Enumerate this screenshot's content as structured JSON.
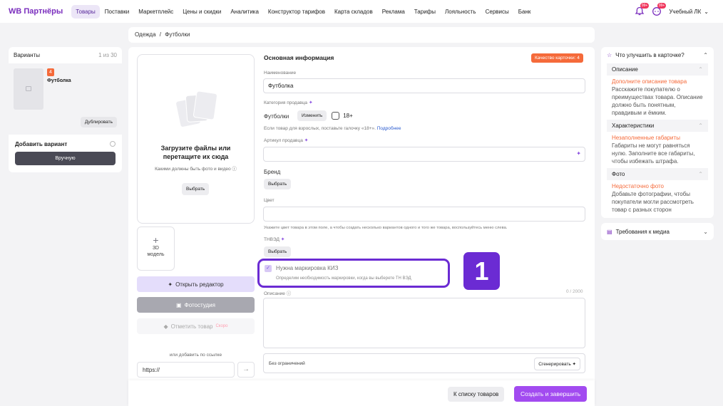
{
  "nav": {
    "logo": "WB Партнёры",
    "items": [
      "Товары",
      "Поставки",
      "Маркетплейс",
      "Цены и скидки",
      "Аналитика",
      "Конструктор тарифов",
      "Карта складов",
      "Реклама",
      "Тарифы",
      "Лояльность",
      "Сервисы",
      "Банк"
    ],
    "badge1": "99+",
    "badge2": "99+",
    "user": "Учебный ЛК"
  },
  "breadcrumb": {
    "root": "Одежда",
    "sep": "/",
    "current": "Футболки"
  },
  "variants": {
    "title": "Варианты",
    "count": "1 из 30",
    "badge": "4",
    "name": "Футболка",
    "duplicate": "Дублировать",
    "add": "Добавить вариант",
    "manual": "Вручную"
  },
  "upload": {
    "title": "Загрузите файлы или перетащите их сюда",
    "subtitle": "Какими должны быть фото и видео",
    "choose": "Выбрать",
    "model3d": "3D модель",
    "editor": "Открыть редактор",
    "studio": "Фотостудия",
    "mark": "Отметить товар",
    "soon": "Скоро",
    "or_link": "или добавить по ссылке",
    "url_value": "https://"
  },
  "form": {
    "section_title": "Основная информация",
    "quality": "Качество карточки: 4",
    "name_label": "Наименование",
    "name_value": "Футболка",
    "category_label": "Категория продавца",
    "category_value": "Футболки",
    "change": "Изменить",
    "adult": "18+",
    "adult_hint": "Если товар для взрослых, поставьте галочку «18+».",
    "more": "Подробнее",
    "article_label": "Артикул продавца",
    "brand_label": "Бренд",
    "choose": "Выбрать",
    "color_label": "Цвет",
    "color_hint": "Укажите цвет товара в этом поле, а чтобы создать несколько вариантов одного и того же товара, воспользуйтесь меню слева.",
    "tnved_label": "ТНВЭД",
    "kiz_label": "Нужна маркировка КИЗ",
    "kiz_hint": "Определим необходимость маркировки, когда вы выберете ТН ВЭД",
    "step": "1",
    "desc_label": "Описание",
    "desc_count": "0 / 2000",
    "no_limits": "Без ограничений",
    "generate": "Сгенерировать",
    "to_list": "К списку товаров",
    "create": "Создать и завершить"
  },
  "tips": {
    "title": "Что улучшить в карточке?",
    "sections": [
      {
        "head": "Описание",
        "link": "Дополните описание товара",
        "text": "Расскажите покупателю о преимуществах товара. Описание должно быть понятным, правдивым и ёмким."
      },
      {
        "head": "Характеристики",
        "link": "Незаполненные габариты",
        "text": "Габариты не могут равняться нулю. Заполните все габариты, чтобы избежать штрафа."
      },
      {
        "head": "Фото",
        "link": "Недостаточно фото",
        "text": "Добавьте фотографии, чтобы покупатели могли рассмотреть товар с разных сторон"
      }
    ],
    "media": "Требования к медиа"
  }
}
